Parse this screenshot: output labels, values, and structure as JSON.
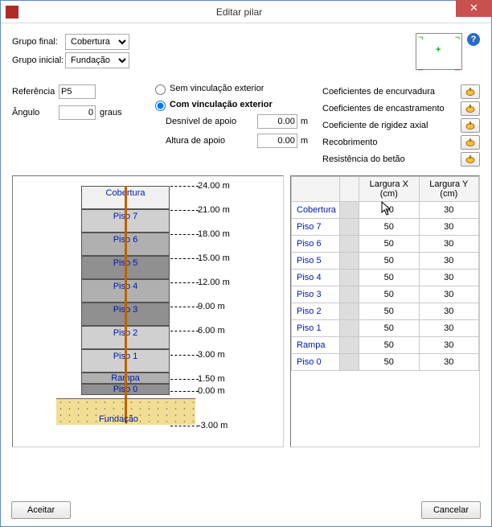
{
  "window": {
    "title": "Editar pilar",
    "close_glyph": "✕"
  },
  "top": {
    "grupo_final_label": "Grupo final:",
    "grupo_inicial_label": "Grupo inicial:",
    "grupo_final_value": "Cobertura",
    "grupo_inicial_value": "Fundação"
  },
  "mid": {
    "referencia_label": "Referência",
    "referencia_value": "P5",
    "angulo_label": "Ângulo",
    "angulo_value": "0",
    "angulo_unit": "graus",
    "radio1": "Sem vinculação exterior",
    "radio2": "Com vinculação exterior",
    "desnivel_label": "Desnível de apoio",
    "desnivel_value": "0.00",
    "altura_label": "Altura de apoio",
    "altura_value": "0.00",
    "unit_m": "m"
  },
  "coefs": [
    "Coeficientes de encurvadura",
    "Coeficientes de encastramento",
    "Coeficiente de rigidez axial",
    "Recobrimento",
    "Resistência do betão"
  ],
  "elevation": {
    "fundacao": "Fundação",
    "levels": [
      {
        "name": "Cobertura",
        "h": "24.00 m",
        "shade": "c1",
        "short": false
      },
      {
        "name": "Piso 7",
        "h": "21.00 m",
        "shade": "c2",
        "short": false
      },
      {
        "name": "Piso 6",
        "h": "18.00 m",
        "shade": "c3",
        "short": false
      },
      {
        "name": "Piso 5",
        "h": "15.00 m",
        "shade": "c4",
        "short": false
      },
      {
        "name": "Piso 4",
        "h": "12.00 m",
        "shade": "c3",
        "short": false
      },
      {
        "name": "Piso 3",
        "h": "9.00 m",
        "shade": "c4",
        "short": false
      },
      {
        "name": "Piso 2",
        "h": "6.00 m",
        "shade": "c2",
        "short": false
      },
      {
        "name": "Piso 1",
        "h": "3.00 m",
        "shade": "c2",
        "short": false
      },
      {
        "name": "Rampa",
        "h": "1.50 m",
        "shade": "c3",
        "short": true
      },
      {
        "name": "Piso 0",
        "h": "0.00 m",
        "shade": "c4",
        "short": true
      }
    ],
    "bottom_h": "-3.00 m"
  },
  "table": {
    "col_x": "Largura X (cm)",
    "col_y": "Largura Y (cm)",
    "rows": [
      {
        "name": "Cobertura",
        "x": "50",
        "y": "30"
      },
      {
        "name": "Piso 7",
        "x": "50",
        "y": "30"
      },
      {
        "name": "Piso 6",
        "x": "50",
        "y": "30"
      },
      {
        "name": "Piso 5",
        "x": "50",
        "y": "30"
      },
      {
        "name": "Piso 4",
        "x": "50",
        "y": "30"
      },
      {
        "name": "Piso 3",
        "x": "50",
        "y": "30"
      },
      {
        "name": "Piso 2",
        "x": "50",
        "y": "30"
      },
      {
        "name": "Piso 1",
        "x": "50",
        "y": "30"
      },
      {
        "name": "Rampa",
        "x": "50",
        "y": "30"
      },
      {
        "name": "Piso 0",
        "x": "50",
        "y": "30"
      }
    ]
  },
  "footer": {
    "accept": "Aceitar",
    "cancel": "Cancelar"
  },
  "help_glyph": "?"
}
